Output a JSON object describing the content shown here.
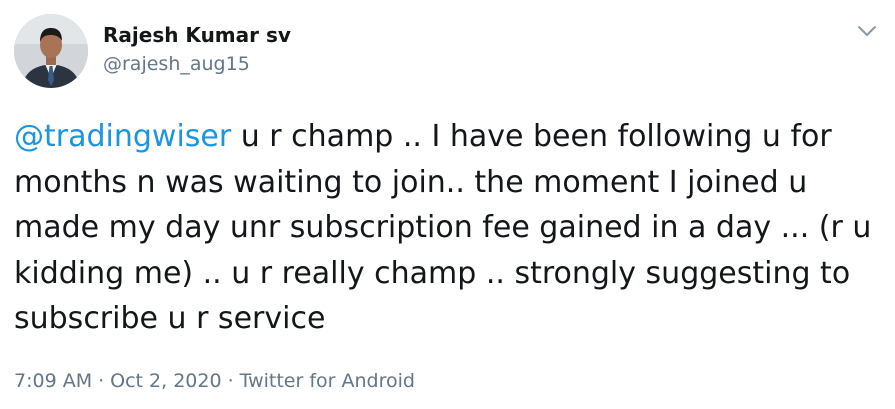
{
  "tweet": {
    "author": {
      "display_name": "Rajesh Kumar sv",
      "handle": "@rajesh_aug15",
      "avatar_icon": "profile-photo"
    },
    "menu_icon": "chevron-down-icon",
    "mention": "@tradingwiser",
    "text_after_mention": " u r champ .. I have been following u for months n was waiting to join.. the moment I joined u made my day unr subscription fee gained in a day ... (r u kidding me) .. u r really champ .. strongly suggesting to subscribe u r service",
    "time": "7:09 AM",
    "separator": "·",
    "date": "Oct 2, 2020",
    "source": "Twitter for Android"
  },
  "colors": {
    "link": "#1b95e0",
    "text": "#14171a",
    "muted": "#657786"
  }
}
